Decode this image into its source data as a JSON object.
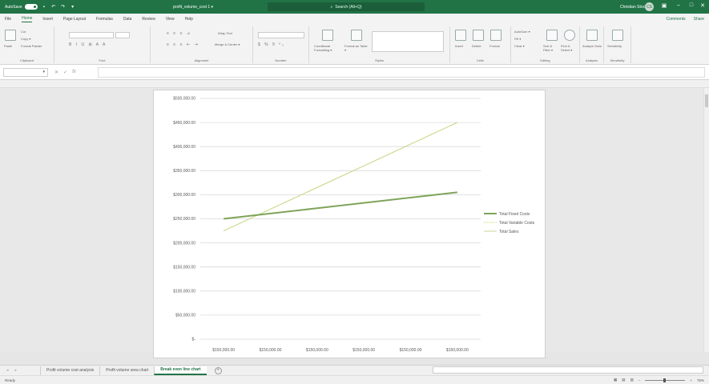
{
  "titlebar": {
    "autosave_label": "AutoSave",
    "autosave_state": "Off",
    "doc_title": "profit_volume_cost 1 ▾",
    "search_placeholder": "Search (Alt+Q)",
    "user_name": "Christian Stock",
    "user_initials": "CS",
    "minimize": "–",
    "maximize": "□",
    "close": "✕",
    "ribbon_display": "▣"
  },
  "ribbon_tabs": {
    "items": [
      "File",
      "Home",
      "Insert",
      "Page Layout",
      "Formulas",
      "Data",
      "Review",
      "View",
      "Help"
    ],
    "active": "Home",
    "comments": "Comments",
    "share": "Share"
  },
  "ribbon": {
    "clipboard": {
      "label": "Clipboard",
      "paste": "Paste",
      "cut": "Cut",
      "copy": "Copy ▾",
      "format_painter": "Format Painter"
    },
    "font": {
      "label": "Font"
    },
    "alignment": {
      "label": "Alignment",
      "wrap_text": "Wrap Text",
      "merge_center": "Merge & Center ▾"
    },
    "number": {
      "label": "Number"
    },
    "styles": {
      "label": "Styles",
      "conditional": "Conditional Formatting ▾",
      "format_table": "Format as Table ▾"
    },
    "cells": {
      "label": "Cells",
      "insert": "Insert",
      "delete": "Delete",
      "format": "Format"
    },
    "editing": {
      "label": "Editing",
      "autosum": "AutoSum ▾",
      "fill": "Fill ▾",
      "clear": "Clear ▾",
      "sort_filter": "Sort & Filter ▾",
      "find_select": "Find & Select ▾"
    },
    "analysis": {
      "label": "Analysis",
      "analyze_data": "Analyze Data"
    },
    "sensitivity": {
      "label": "Sensitivity",
      "button": "Sensitivity"
    }
  },
  "formula_bar": {
    "fx": "fx",
    "cancel": "✕",
    "enter": "✓",
    "value": ""
  },
  "sheet_tabs": {
    "items": [
      "Profit volume cost analysis",
      "Profit volume area chart",
      "Break even line chart"
    ],
    "active": "Break even line chart",
    "add": "+"
  },
  "statusbar": {
    "ready": "Ready",
    "zoom": "75%"
  },
  "colors": {
    "excel_green": "#217346",
    "fixed_costs": "#7fa45a",
    "variable_costs": "#c8d96f",
    "total_sales": "#c7d79a"
  },
  "chart_data": {
    "type": "line",
    "title": "",
    "xlabel": "",
    "ylabel": "",
    "categories": [
      "$150,000.00",
      "$150,000.00",
      "$150,000.00",
      "$150,000.00",
      "$150,000.00",
      "$150,000.00"
    ],
    "y_ticks": [
      "$-",
      "$50,000.00",
      "$100,000.00",
      "$150,000.00",
      "$200,000.00",
      "$250,000.00",
      "$300,000.00",
      "$350,000.00",
      "$400,000.00",
      "$450,000.00",
      "$500,000.00"
    ],
    "ylim": [
      0,
      500000
    ],
    "grid": true,
    "legend_position": "right",
    "series": [
      {
        "name": "Total Fixed Costs",
        "values": [
          250000,
          261000,
          272000,
          283000,
          294000,
          305000
        ],
        "color": "#7fa45a",
        "style": "solid"
      },
      {
        "name": "Total Variable Costs",
        "values": [
          225000,
          270000,
          315000,
          360000,
          405000,
          450000
        ],
        "color": "#c8d96f",
        "style": "dotted"
      },
      {
        "name": "Total Sales",
        "values": [
          225000,
          270000,
          315000,
          360000,
          405000,
          450000
        ],
        "color": "#c7d79a",
        "style": "solid"
      }
    ]
  }
}
